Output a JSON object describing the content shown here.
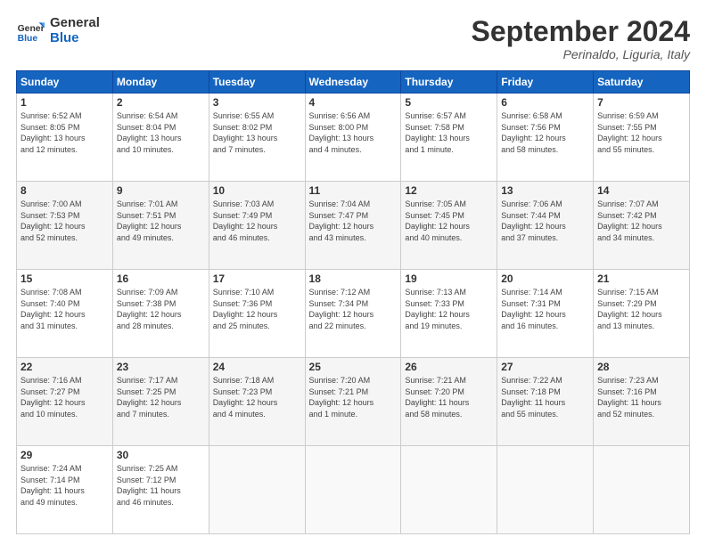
{
  "header": {
    "logo_line1": "General",
    "logo_line2": "Blue",
    "month": "September 2024",
    "location": "Perinaldo, Liguria, Italy"
  },
  "weekdays": [
    "Sunday",
    "Monday",
    "Tuesday",
    "Wednesday",
    "Thursday",
    "Friday",
    "Saturday"
  ],
  "weeks": [
    [
      {
        "day": "1",
        "info": "Sunrise: 6:52 AM\nSunset: 8:05 PM\nDaylight: 13 hours\nand 12 minutes."
      },
      {
        "day": "2",
        "info": "Sunrise: 6:54 AM\nSunset: 8:04 PM\nDaylight: 13 hours\nand 10 minutes."
      },
      {
        "day": "3",
        "info": "Sunrise: 6:55 AM\nSunset: 8:02 PM\nDaylight: 13 hours\nand 7 minutes."
      },
      {
        "day": "4",
        "info": "Sunrise: 6:56 AM\nSunset: 8:00 PM\nDaylight: 13 hours\nand 4 minutes."
      },
      {
        "day": "5",
        "info": "Sunrise: 6:57 AM\nSunset: 7:58 PM\nDaylight: 13 hours\nand 1 minute."
      },
      {
        "day": "6",
        "info": "Sunrise: 6:58 AM\nSunset: 7:56 PM\nDaylight: 12 hours\nand 58 minutes."
      },
      {
        "day": "7",
        "info": "Sunrise: 6:59 AM\nSunset: 7:55 PM\nDaylight: 12 hours\nand 55 minutes."
      }
    ],
    [
      {
        "day": "8",
        "info": "Sunrise: 7:00 AM\nSunset: 7:53 PM\nDaylight: 12 hours\nand 52 minutes."
      },
      {
        "day": "9",
        "info": "Sunrise: 7:01 AM\nSunset: 7:51 PM\nDaylight: 12 hours\nand 49 minutes."
      },
      {
        "day": "10",
        "info": "Sunrise: 7:03 AM\nSunset: 7:49 PM\nDaylight: 12 hours\nand 46 minutes."
      },
      {
        "day": "11",
        "info": "Sunrise: 7:04 AM\nSunset: 7:47 PM\nDaylight: 12 hours\nand 43 minutes."
      },
      {
        "day": "12",
        "info": "Sunrise: 7:05 AM\nSunset: 7:45 PM\nDaylight: 12 hours\nand 40 minutes."
      },
      {
        "day": "13",
        "info": "Sunrise: 7:06 AM\nSunset: 7:44 PM\nDaylight: 12 hours\nand 37 minutes."
      },
      {
        "day": "14",
        "info": "Sunrise: 7:07 AM\nSunset: 7:42 PM\nDaylight: 12 hours\nand 34 minutes."
      }
    ],
    [
      {
        "day": "15",
        "info": "Sunrise: 7:08 AM\nSunset: 7:40 PM\nDaylight: 12 hours\nand 31 minutes."
      },
      {
        "day": "16",
        "info": "Sunrise: 7:09 AM\nSunset: 7:38 PM\nDaylight: 12 hours\nand 28 minutes."
      },
      {
        "day": "17",
        "info": "Sunrise: 7:10 AM\nSunset: 7:36 PM\nDaylight: 12 hours\nand 25 minutes."
      },
      {
        "day": "18",
        "info": "Sunrise: 7:12 AM\nSunset: 7:34 PM\nDaylight: 12 hours\nand 22 minutes."
      },
      {
        "day": "19",
        "info": "Sunrise: 7:13 AM\nSunset: 7:33 PM\nDaylight: 12 hours\nand 19 minutes."
      },
      {
        "day": "20",
        "info": "Sunrise: 7:14 AM\nSunset: 7:31 PM\nDaylight: 12 hours\nand 16 minutes."
      },
      {
        "day": "21",
        "info": "Sunrise: 7:15 AM\nSunset: 7:29 PM\nDaylight: 12 hours\nand 13 minutes."
      }
    ],
    [
      {
        "day": "22",
        "info": "Sunrise: 7:16 AM\nSunset: 7:27 PM\nDaylight: 12 hours\nand 10 minutes."
      },
      {
        "day": "23",
        "info": "Sunrise: 7:17 AM\nSunset: 7:25 PM\nDaylight: 12 hours\nand 7 minutes."
      },
      {
        "day": "24",
        "info": "Sunrise: 7:18 AM\nSunset: 7:23 PM\nDaylight: 12 hours\nand 4 minutes."
      },
      {
        "day": "25",
        "info": "Sunrise: 7:20 AM\nSunset: 7:21 PM\nDaylight: 12 hours\nand 1 minute."
      },
      {
        "day": "26",
        "info": "Sunrise: 7:21 AM\nSunset: 7:20 PM\nDaylight: 11 hours\nand 58 minutes."
      },
      {
        "day": "27",
        "info": "Sunrise: 7:22 AM\nSunset: 7:18 PM\nDaylight: 11 hours\nand 55 minutes."
      },
      {
        "day": "28",
        "info": "Sunrise: 7:23 AM\nSunset: 7:16 PM\nDaylight: 11 hours\nand 52 minutes."
      }
    ],
    [
      {
        "day": "29",
        "info": "Sunrise: 7:24 AM\nSunset: 7:14 PM\nDaylight: 11 hours\nand 49 minutes."
      },
      {
        "day": "30",
        "info": "Sunrise: 7:25 AM\nSunset: 7:12 PM\nDaylight: 11 hours\nand 46 minutes."
      },
      {
        "day": "",
        "info": ""
      },
      {
        "day": "",
        "info": ""
      },
      {
        "day": "",
        "info": ""
      },
      {
        "day": "",
        "info": ""
      },
      {
        "day": "",
        "info": ""
      }
    ]
  ]
}
